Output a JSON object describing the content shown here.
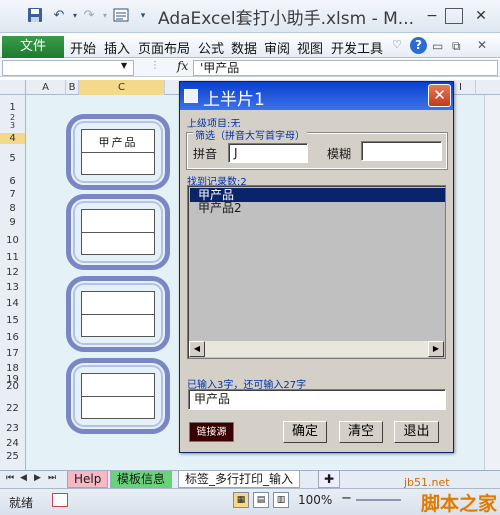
{
  "window": {
    "title": "AdaExcel套打小助手.xlsm - M...",
    "quick_access": {
      "save_icon": "save-icon",
      "undo_icon": "undo-icon",
      "redo_icon": "redo-icon",
      "form_icon": "form-icon",
      "dropdown_icon": "dropdown-icon"
    },
    "controls": {
      "minimize": "−",
      "maximize": "☐",
      "close": "✕"
    }
  },
  "ribbon": {
    "file": "文件",
    "tabs": [
      "开始",
      "插入",
      "页面布局",
      "公式",
      "数据",
      "审阅",
      "视图",
      "开发工具"
    ],
    "help_glyph": "?",
    "minimize_glyph": "♡"
  },
  "formula_bar": {
    "fx": "fx",
    "value": "'甲产品"
  },
  "sheet": {
    "columns": [
      "A",
      "B",
      "C",
      "I"
    ],
    "rows": [
      "1",
      "2",
      "3",
      "4",
      "5",
      "6",
      "7",
      "8",
      "9",
      "10",
      "11",
      "12",
      "13",
      "14",
      "15",
      "16",
      "17",
      "18",
      "19",
      "20",
      "21",
      "22",
      "23",
      "24",
      "25",
      "26"
    ],
    "label_cells": [
      {
        "text": "甲产品"
      },
      {
        "text": ""
      },
      {
        "text": ""
      },
      {
        "text": ""
      }
    ]
  },
  "dialog": {
    "title": "上半片1",
    "close": "✕",
    "parent_item": "上级项目:无",
    "filter_group": "筛选（拼音大写首字母）",
    "pinyin_label": "拼音",
    "pinyin_value": "J",
    "fuzzy_label": "模糊",
    "fuzzy_value": "",
    "found_label": "找到记录数:2",
    "results": [
      "甲产品",
      "甲产品2"
    ],
    "selected_index": 0,
    "input_hint": "已输入3字，还可输入27字",
    "input_value": "甲产品",
    "link_button": "链接源",
    "ok": "确定",
    "clear": "清空",
    "exit": "退出"
  },
  "sheet_tabs": {
    "tabs": [
      "Help",
      "模板信息",
      "标签_多行打印_输入"
    ]
  },
  "status": {
    "mode": "就绪",
    "zoom": "100%",
    "zoom_minus": "−"
  },
  "watermark": {
    "site": "jb51.net",
    "name": "脚本之家"
  }
}
